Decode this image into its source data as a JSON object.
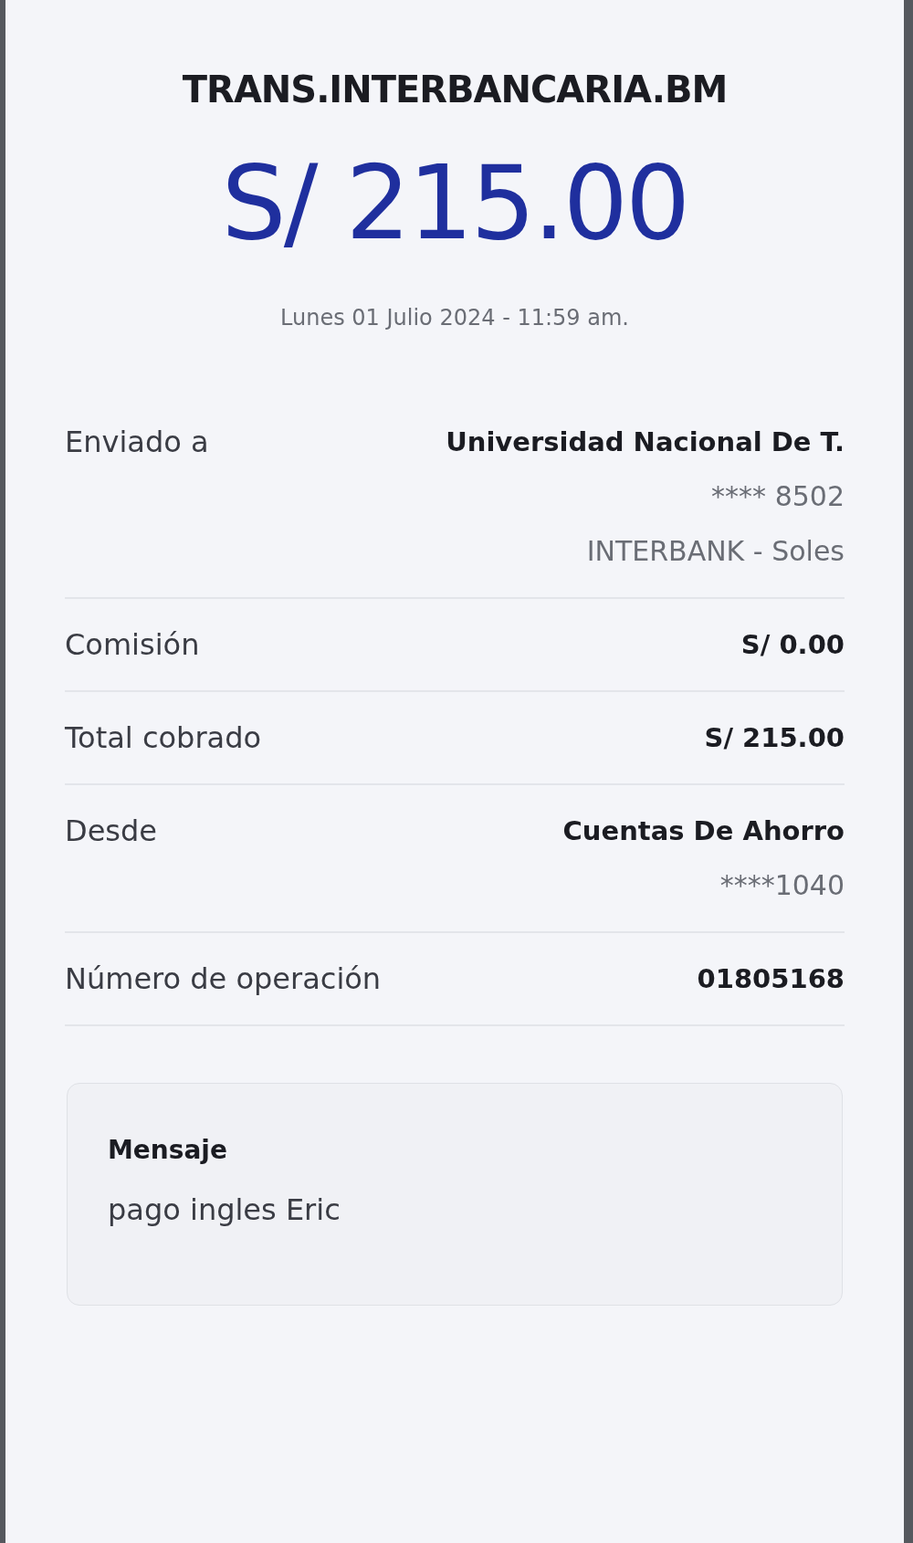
{
  "title": "TRANS.INTERBANCARIA.BM",
  "amount": "S/ 215.00",
  "date": "Lunes 01 Julio 2024 - 11:59 am.",
  "details": [
    {
      "label": "Enviado a",
      "values": [
        {
          "text": "Universidad Nacional De T.",
          "kind": "primary"
        },
        {
          "text": "**** 8502",
          "kind": "secondary"
        },
        {
          "text": "INTERBANK - Soles",
          "kind": "secondary"
        }
      ]
    },
    {
      "label": "Comisión",
      "values": [
        {
          "text": "S/ 0.00",
          "kind": "primary"
        }
      ]
    },
    {
      "label": "Total cobrado",
      "values": [
        {
          "text": "S/ 215.00",
          "kind": "primary"
        }
      ]
    },
    {
      "label": "Desde",
      "values": [
        {
          "text": "Cuentas De Ahorro",
          "kind": "primary"
        },
        {
          "text": "****1040",
          "kind": "secondary"
        }
      ]
    },
    {
      "label": "Número de operación",
      "values": [
        {
          "text": "01805168",
          "kind": "primary"
        }
      ]
    }
  ],
  "message": {
    "label": "Mensaje",
    "text": "pago ingles Eric"
  }
}
